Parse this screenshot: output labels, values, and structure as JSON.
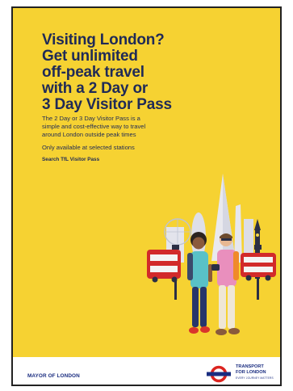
{
  "poster": {
    "headline_lines": [
      "Visiting London?",
      "Get unlimited",
      "off-peak travel",
      "with a 2 Day or",
      "3 Day Visitor Pass"
    ],
    "body_lines": [
      "The 2 Day or 3 Day Visitor Pass is a",
      "simple and cost-effective way to travel",
      "around London outside peak times"
    ],
    "availability": "Only available at selected stations",
    "search_prompt": "Search TfL Visitor Pass"
  },
  "footer": {
    "mayor": "MAYOR OF LONDON",
    "tfl_lines": [
      "TRANSPORT",
      "FOR LONDON"
    ],
    "tfl_strapline": "EVERY JOURNEY MATTERS"
  },
  "colors": {
    "background_yellow": "#f6d232",
    "navy": "#1f2a57",
    "tfl_blue": "#1a2d80",
    "roundel_red": "#dc241f",
    "bus_red": "#d22a2a"
  }
}
